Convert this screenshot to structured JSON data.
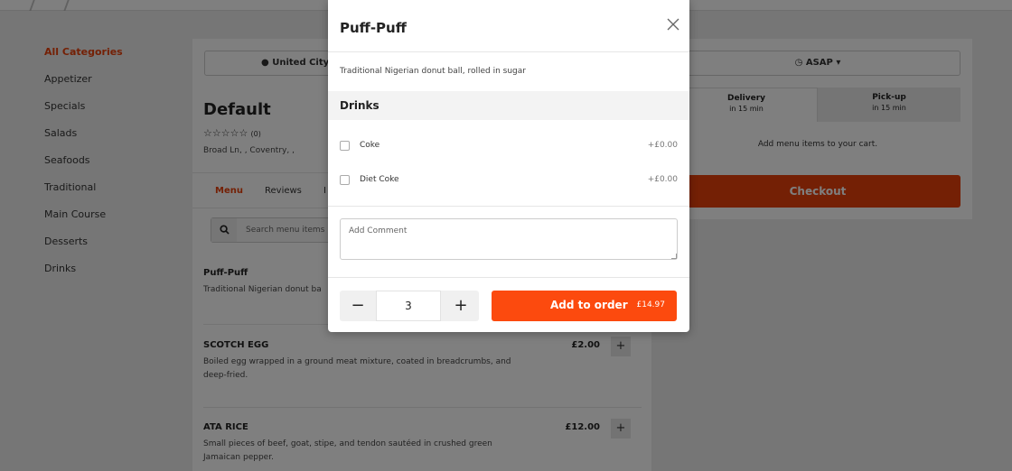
{
  "sidebar": {
    "items": [
      {
        "label": "All Categories",
        "active": true
      },
      {
        "label": "Appetizer"
      },
      {
        "label": "Specials"
      },
      {
        "label": "Salads"
      },
      {
        "label": "Seafoods"
      },
      {
        "label": "Traditional"
      },
      {
        "label": "Main Course"
      },
      {
        "label": "Desserts"
      },
      {
        "label": "Drinks"
      }
    ]
  },
  "store": {
    "location": "United City,",
    "title": "Default",
    "stars": "☆☆☆☆☆",
    "review_count": "(0)",
    "address": "Broad Ln, , Coventry, ,"
  },
  "tabs": {
    "menu": "Menu",
    "reviews": "Reviews",
    "info": "I"
  },
  "search": {
    "placeholder": "Search menu items"
  },
  "menu_items": [
    {
      "name": "Puff-Puff",
      "desc": "Traditional Nigerian donut ba"
    },
    {
      "name": "SCOTCH EGG",
      "desc": "Boiled egg wrapped in a ground meat mixture, coated in breadcrumbs, and deep-fried.",
      "price": "£2.00"
    },
    {
      "name": "ATA RICE",
      "desc": "Small pieces of beef, goat, stipe, and tendon sautéed in crushed green Jamaican pepper.",
      "price": "£12.00"
    }
  ],
  "cart": {
    "time": "ASAP",
    "delivery_label": "Delivery",
    "delivery_time": "in 15 min",
    "pickup_label": "Pick-up",
    "pickup_time": "in 15 min",
    "empty_text": "Add menu items to your cart.",
    "checkout_label": "Checkout"
  },
  "modal": {
    "title": "Puff-Puff",
    "description": "Traditional Nigerian donut ball, rolled in sugar",
    "option_group": "Drinks",
    "options": [
      {
        "label": "Coke",
        "price": "+£0.00"
      },
      {
        "label": "Diet Coke",
        "price": "+£0.00"
      }
    ],
    "comment_placeholder": "Add Comment",
    "quantity": "3",
    "add_label": "Add to order",
    "add_price": "£14.97"
  },
  "colors": {
    "accent": "#e8400a",
    "button": "#fc4a0e"
  }
}
